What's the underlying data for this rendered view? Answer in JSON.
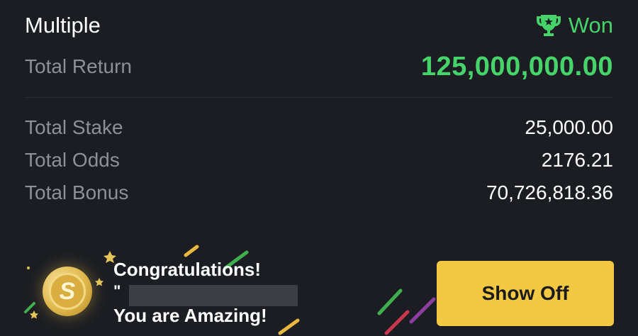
{
  "bet": {
    "type": "Multiple",
    "status": "Won",
    "total_return_label": "Total Return",
    "total_return": "125,000,000.00",
    "total_stake_label": "Total Stake",
    "total_stake": "25,000.00",
    "total_odds_label": "Total Odds",
    "total_odds": "2176.21",
    "total_bonus_label": "Total Bonus",
    "total_bonus": "70,726,818.36"
  },
  "promo": {
    "congrats": "Congratulations!",
    "quote_mark": "\"",
    "message": "You are Amazing!",
    "button": "Show Off"
  },
  "colors": {
    "background": "#1c1d22",
    "won_green": "#46d36a",
    "button_yellow": "#f3c843",
    "label_gray": "#8e9099"
  },
  "icons": {
    "status": "trophy-icon",
    "coin": "coin-icon"
  }
}
